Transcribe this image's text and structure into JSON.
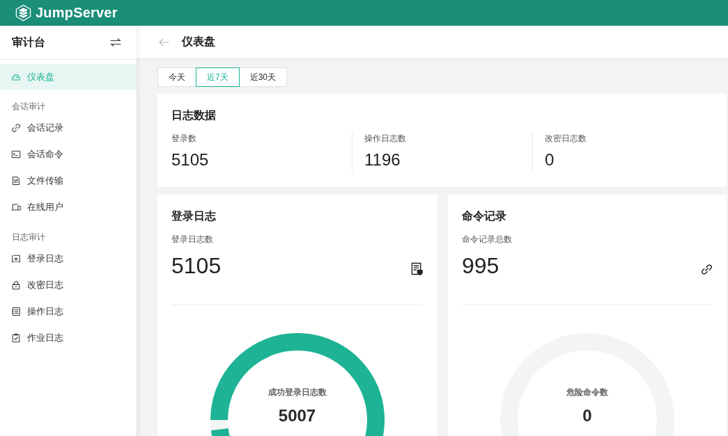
{
  "header": {
    "brand": "JumpServer"
  },
  "sidebar": {
    "title": "审计台",
    "items": [
      {
        "kind": "link",
        "label": "仪表盘",
        "selected": true
      },
      {
        "kind": "section",
        "label": "会话审计"
      },
      {
        "kind": "link",
        "label": "会话记录",
        "selected": false
      },
      {
        "kind": "link",
        "label": "会话命令",
        "selected": false
      },
      {
        "kind": "link",
        "label": "文件传输",
        "selected": false
      },
      {
        "kind": "link",
        "label": "在线用户",
        "selected": false
      },
      {
        "kind": "section",
        "label": "日志审计"
      },
      {
        "kind": "link",
        "label": "登录日志",
        "selected": false
      },
      {
        "kind": "link",
        "label": "改密日志",
        "selected": false
      },
      {
        "kind": "link",
        "label": "操作日志",
        "selected": false
      },
      {
        "kind": "link",
        "label": "作业日志",
        "selected": false
      }
    ]
  },
  "page": {
    "title": "仪表盘"
  },
  "range_tabs": [
    {
      "label": "今天",
      "selected": false
    },
    {
      "label": "近7天",
      "selected": true
    },
    {
      "label": "近30天",
      "selected": false
    }
  ],
  "log_data": {
    "title": "日志数据",
    "stats": [
      {
        "label": "登录数",
        "value": "5105"
      },
      {
        "label": "操作日志数",
        "value": "1196"
      },
      {
        "label": "改密日志数",
        "value": "0"
      }
    ]
  },
  "panels": [
    {
      "title": "登录日志",
      "total_label": "登录日志数",
      "total": "5105",
      "ring": {
        "label": "成功登录日志数",
        "value": "5007"
      }
    },
    {
      "title": "命令记录",
      "total_label": "命令记录总数",
      "total": "995",
      "ring": {
        "label": "危险命令数",
        "value": "0"
      }
    }
  ]
}
